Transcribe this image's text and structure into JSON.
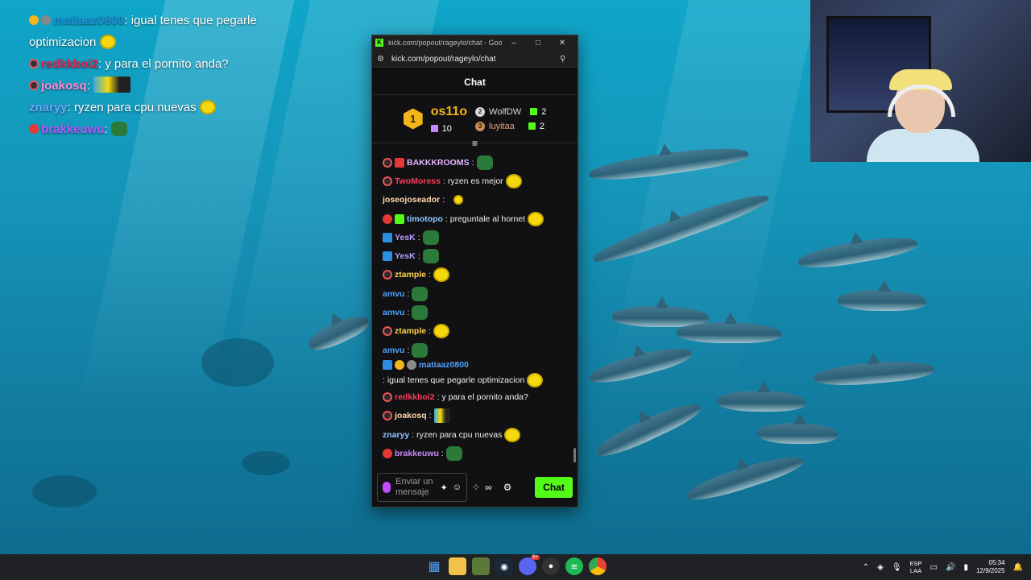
{
  "overlay": {
    "lines": [
      {
        "user": "matiaaz0800",
        "color": "#1f8fd6",
        "text": ": igual tenes que pegarle"
      },
      {
        "user": "",
        "color": "#ffffff",
        "text": "optimizacion"
      },
      {
        "user": "redkkboi2",
        "color": "#e0234d",
        "text": ": y para el pornito anda?"
      },
      {
        "user": "joakosq",
        "color": "#ff8ad8",
        "text": ":"
      },
      {
        "user": "znaryy",
        "color": "#6fa8ff",
        "text": ": ryzen para cpu nuevas"
      },
      {
        "user": "brakkeuwu",
        "color": "#b05bff",
        "text": ":"
      }
    ]
  },
  "browser": {
    "title": "kick.com/popout/rageylo/chat - Google...",
    "url": "kick.com/popout/rageylo/chat",
    "logo_letter": "K",
    "minimize": "–",
    "maximize": "□",
    "close": "✕",
    "zoom_icon": "⚲",
    "site_icon": "⚙"
  },
  "chat": {
    "header": "Chat",
    "leaderboard": {
      "first": {
        "rank": "1",
        "name": "os11o",
        "gifts": "10"
      },
      "second": {
        "rank": "2",
        "name": "WolfDW",
        "gifts": "2"
      },
      "third": {
        "rank": "3",
        "name": "luyitaa",
        "gifts": "2"
      }
    },
    "messages": [
      {
        "user": "BAKKKROOMS",
        "color": "#e5b3ff",
        "text": ":",
        "emote": "green",
        "badges": [
          "mod",
          "red-sq"
        ]
      },
      {
        "user": "TwoMoress",
        "color": "#ff3b5c",
        "text": ": ryzen es mejor",
        "emote": "yellow",
        "badges": [
          "mod"
        ]
      },
      {
        "user": "joseojoseador",
        "color": "#ffd9a8",
        "text": ":",
        "emote": "small",
        "badges": []
      },
      {
        "user": "timotopo",
        "color": "#8ec6ff",
        "text": ": preguntale al hornet",
        "emote": "yellow",
        "badges": [
          "red",
          "green-sq"
        ]
      },
      {
        "user": "YesK",
        "color": "#b89cff",
        "text": ":",
        "emote": "green",
        "badges": [
          "blue-sq"
        ]
      },
      {
        "user": "YesK",
        "color": "#b89cff",
        "text": ":",
        "emote": "green",
        "badges": [
          "blue-sq"
        ]
      },
      {
        "user": "ztample",
        "color": "#ffd34d",
        "text": ":",
        "emote": "yellow",
        "badges": [
          "mod"
        ]
      },
      {
        "user": "amvu",
        "color": "#4fa3ff",
        "text": ":",
        "emote": "green",
        "badges": []
      },
      {
        "user": "amvu",
        "color": "#4fa3ff",
        "text": ":",
        "emote": "green",
        "badges": []
      },
      {
        "user": "ztample",
        "color": "#ffd34d",
        "text": ":",
        "emote": "yellow",
        "badges": [
          "mod"
        ]
      },
      {
        "user": "amvu",
        "color": "#4fa3ff",
        "text": ":",
        "emote": "green",
        "badges": []
      },
      {
        "user": "matiaaz0800",
        "color": "#4fa3ff",
        "text": ": igual tenes que pegarle optimizacion",
        "emote": "yellow",
        "badges": [
          "blue-sq",
          "gold",
          "grey"
        ]
      },
      {
        "user": "redkkboi2",
        "color": "#ff3b5c",
        "text": ": y para el pornito anda?",
        "emote": "",
        "badges": [
          "mod"
        ]
      },
      {
        "user": "joakosq",
        "color": "#ffd9a8",
        "text": ":",
        "emote": "wide",
        "badges": [
          "mod"
        ]
      },
      {
        "user": "znaryy",
        "color": "#8ec6ff",
        "text": ": ryzen para cpu nuevas",
        "emote": "yellow",
        "badges": []
      },
      {
        "user": "brakkeuwu",
        "color": "#c58af9",
        "text": ":",
        "emote": "green",
        "badges": [
          "red"
        ]
      }
    ],
    "input_placeholder": "Enviar un mensaje",
    "send_label": "Chat"
  },
  "taskbar": {
    "lang_top": "ESP",
    "lang_bottom": "LAA",
    "time": "05:34",
    "date": "12/9/2025",
    "discord_badge": "9+"
  },
  "colors": {
    "kick_green": "#53fc18",
    "accent_gold": "#f2b51a"
  }
}
